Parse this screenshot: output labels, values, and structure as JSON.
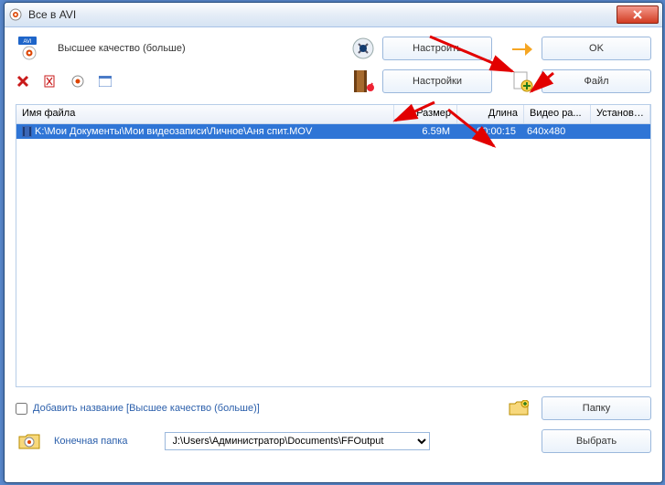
{
  "window": {
    "title": "Все в AVI"
  },
  "toolbar": {
    "quality_label": "Высшее качество (больше)",
    "configure_label": "Настроить",
    "ok_label": "OK",
    "settings_label": "Настройки",
    "file_label": "Файл"
  },
  "columns": {
    "c1": "Имя файла",
    "c2": "Размер",
    "c3": "Длина",
    "c4": "Видео ра...",
    "c5": "Установить диа..."
  },
  "rows": [
    {
      "file": "K:\\Мои Документы\\Мои видеозаписи\\Личное\\Аня спит.MOV",
      "size": "6.59M",
      "len": "00:00:15",
      "res": "640x480",
      "dia": ""
    }
  ],
  "footer": {
    "add_title_label": "Добавить название [Высшее качество (больше)]",
    "folder_button": "Папку",
    "output_label": "Конечная папка",
    "output_path": "J:\\Users\\Администратор\\Documents\\FFOutput",
    "select_button": "Выбрать"
  }
}
